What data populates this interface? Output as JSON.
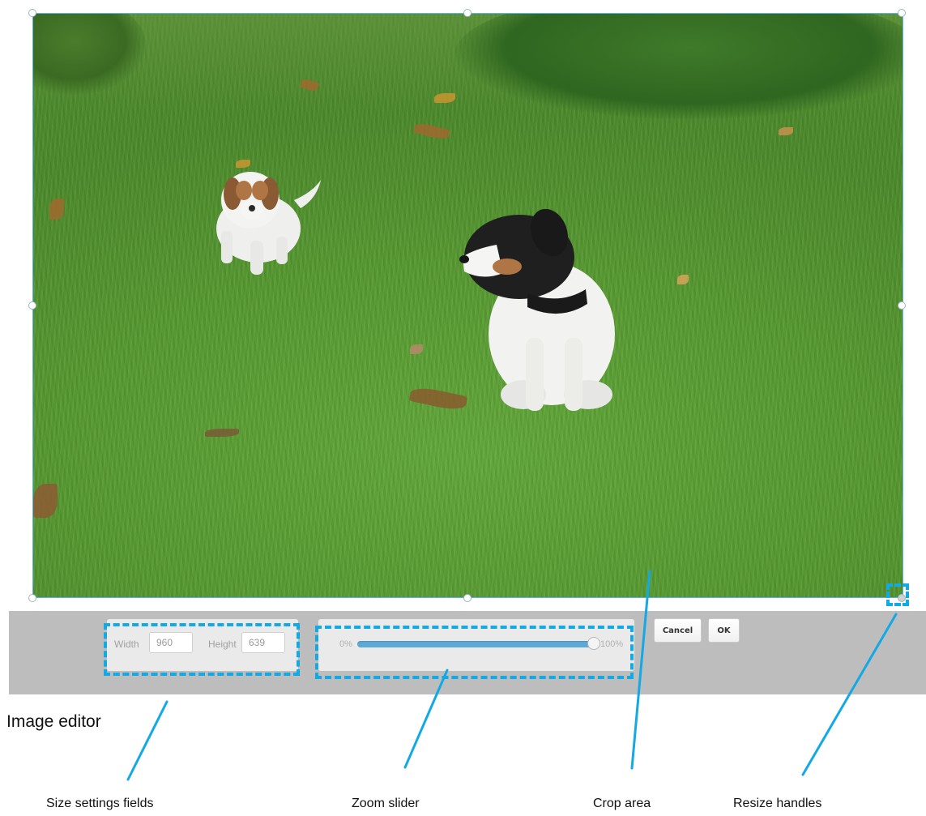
{
  "editor": {
    "size": {
      "width_label": "Width",
      "width_value": "960",
      "height_label": "Height",
      "height_value": "639"
    },
    "zoom": {
      "min_label": "0%",
      "max_label": "100%",
      "value_percent": 100
    },
    "buttons": {
      "cancel": "Cancel",
      "ok": "OK"
    }
  },
  "annotations": {
    "title": "Image editor",
    "callouts": {
      "size_fields": "Size settings fields",
      "zoom_slider": "Zoom slider",
      "crop_area": "Crop area",
      "resize_handles": "Resize handles"
    },
    "color": "#12a9e4"
  },
  "colors": {
    "accent": "#5ba9d8",
    "toolbar_bg": "#bdbdbd",
    "crop_border": "#5ab4dd"
  }
}
